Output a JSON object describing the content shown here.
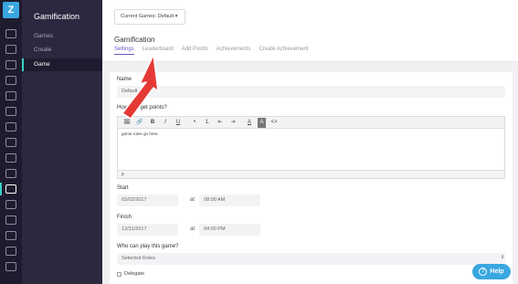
{
  "rail": {
    "logo": "Z",
    "icons": [
      "dashboard-icon",
      "inbox-icon",
      "users-icon",
      "calendar-icon",
      "reports-icon",
      "chart-icon",
      "messages-icon",
      "list-icon",
      "tools-icon",
      "copy-icon",
      "trophy-icon",
      "grid-icon",
      "table-icon",
      "eye-icon",
      "card-icon",
      "settings-icon",
      "logout-icon"
    ]
  },
  "sidebar": {
    "title": "Gamification",
    "items": [
      {
        "label": "Games"
      },
      {
        "label": "Create"
      },
      {
        "label": "Game"
      }
    ]
  },
  "header": {
    "game_select": "Current Games: Default ▾",
    "title": "Gamification",
    "tabs": [
      {
        "label": "Settings"
      },
      {
        "label": "Leaderboard"
      },
      {
        "label": "Add Points"
      },
      {
        "label": "Achievements"
      },
      {
        "label": "Create Achievement"
      }
    ]
  },
  "form": {
    "name_label": "Name",
    "name_value": "Default",
    "how_label": "How do I get points?",
    "toolbar": [
      "🖼",
      "🔗",
      "B",
      "I",
      "U",
      "•",
      "1.",
      "⇤",
      "⇥",
      "A",
      "A",
      "<>"
    ],
    "editor_text": "game rules go here.",
    "editor_footer": "p",
    "start_label": "Start",
    "start_date": "02/02/2017",
    "start_at": "at",
    "start_time": "08:00 AM",
    "finish_label": "Finish",
    "finish_date": "12/31/2017",
    "finish_at": "at",
    "finish_time": "04:00 PM",
    "play_label": "Who can play this game?",
    "play_value": "Selected Roles",
    "roles": [
      {
        "label": "Delegate"
      }
    ]
  },
  "help": {
    "label": "Help",
    "icon": "?"
  },
  "colors": {
    "accent": "#6a5acd",
    "help": "#3aa7e0",
    "arrow": "#e53935"
  }
}
